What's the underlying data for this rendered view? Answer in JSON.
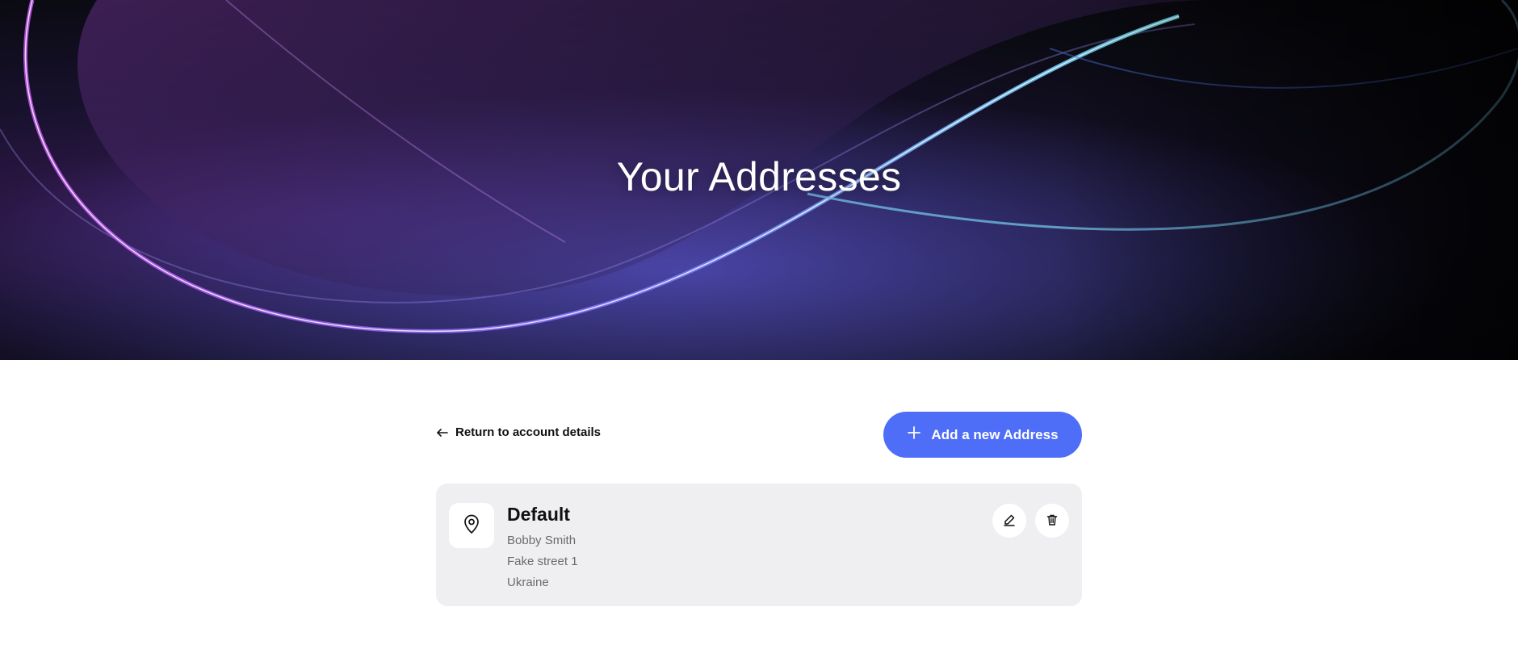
{
  "hero": {
    "title": "Your Addresses"
  },
  "toolbar": {
    "back_label": "Return to account details",
    "back_icon": "arrow-left-icon",
    "add_label": "Add a new Address",
    "add_icon": "plus-icon"
  },
  "address": {
    "title": "Default",
    "name": "Bobby Smith",
    "street": "Fake street 1",
    "country": "Ukraine",
    "pin_icon": "map-pin-icon",
    "edit_icon": "pencil-icon",
    "delete_icon": "trash-icon"
  },
  "colors": {
    "accent": "#4f6ef7",
    "card_background": "#efeff1",
    "muted_text": "#6b6b70"
  }
}
